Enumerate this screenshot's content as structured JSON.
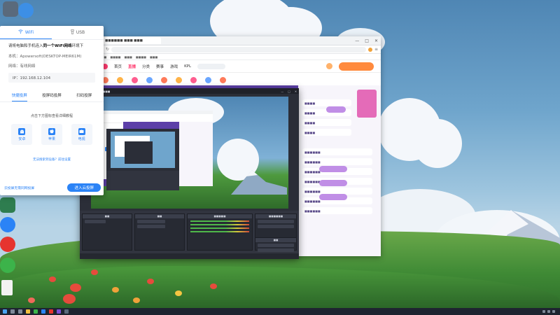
{
  "popup": {
    "tabs": [
      {
        "label": "WiFi",
        "icon": "wifi-icon",
        "active": true
      },
      {
        "label": "USB",
        "icon": "usb-icon",
        "active": false
      }
    ],
    "instruction_prefix": "请将电脑和手机连入",
    "instruction_bold": "同一个WiFi网络",
    "instruction_suffix": "环境下",
    "local_label": "本机：Apowersoft(DESKTOP-MEIR61M)",
    "network_label": "网络：有线网络",
    "ip_label": "IP：192.168.12.104",
    "modes": [
      {
        "label": "快捷投屏",
        "active": true
      },
      {
        "label": "投屏码投屏",
        "active": false
      },
      {
        "label": "扫码投屏",
        "active": false
      }
    ],
    "hint": "点击下方图标查看详细教程",
    "devices": [
      {
        "label": "安卓",
        "icon": "android-icon"
      },
      {
        "label": "苹果",
        "icon": "apple-icon"
      },
      {
        "label": "电视",
        "icon": "tv-icon"
      }
    ],
    "help_link": "无法搜索到设备？前往设置",
    "footer_link": "云投屏无需同网投屏",
    "footer_button": "进入云投屏"
  },
  "browser": {
    "tab_title": "■■■■■■ ■■■ ■■■",
    "url": "",
    "bookmarks": [
      "■■■",
      "■■■■",
      "■■■",
      "■■■■",
      "■■■"
    ],
    "nav": [
      {
        "label": "首页",
        "active": false
      },
      {
        "label": "直播",
        "active": true
      },
      {
        "label": "分类",
        "active": false
      },
      {
        "label": "赛事",
        "active": false
      },
      {
        "label": "游戏",
        "active": false
      },
      {
        "label": "KPL",
        "active": false
      }
    ]
  },
  "obs": {
    "title": "OBS ■■■ ■ ■■■■",
    "docks": [
      "■■",
      "■■",
      "■■■■■",
      "■■■■■■",
      "■■"
    ]
  },
  "colors": {
    "accent": "#2b83f6",
    "brand_pink": "#ff3a6e",
    "site_purple": "#5c3fa8"
  }
}
